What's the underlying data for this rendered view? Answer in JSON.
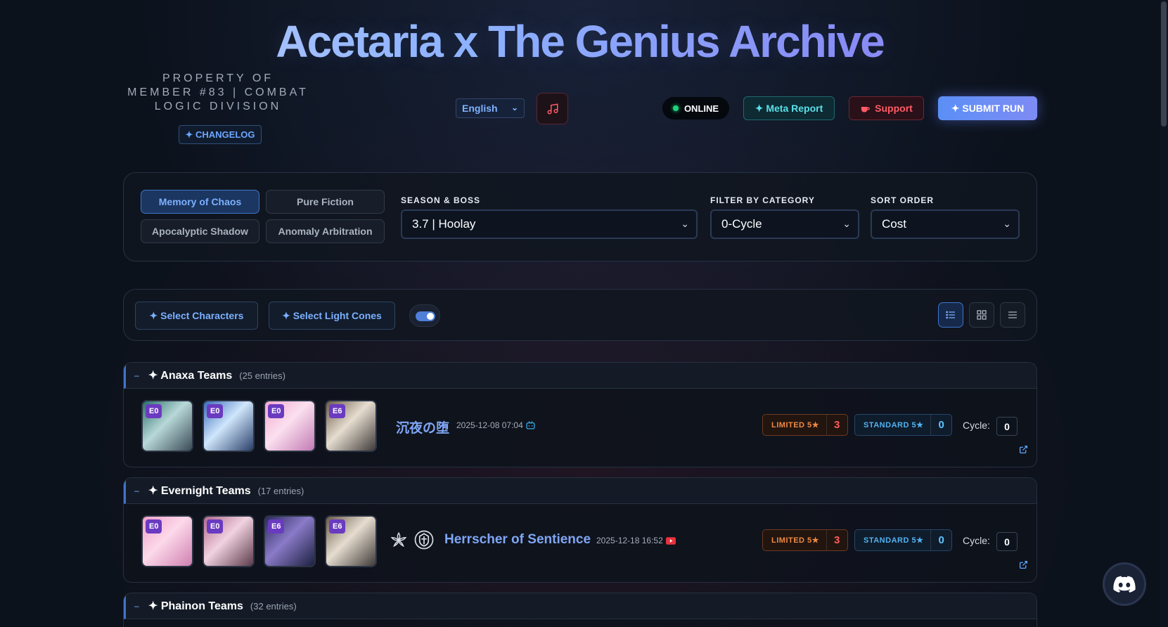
{
  "header": {
    "title": "Acetaria x The Genius Archive",
    "property_line": "PROPERTY OF MEMBER #83 | COMBAT LOGIC DIVISION",
    "changelog_label": "✦ CHANGELOG",
    "language": "English",
    "status": "ONLINE",
    "meta_report_label": "✦ Meta Report",
    "support_label": "Support",
    "submit_label": "✦ SUBMIT RUN"
  },
  "modes": [
    "Memory of Chaos",
    "Pure Fiction",
    "Apocalyptic Shadow",
    "Anomaly Arbitration"
  ],
  "active_mode": "Memory of Chaos",
  "filters": {
    "season_label": "SEASON & BOSS",
    "season_value": "3.7 | Hoolay",
    "category_label": "FILTER BY CATEGORY",
    "category_value": "0-Cycle",
    "sort_label": "SORT ORDER",
    "sort_value": "Cost"
  },
  "toolbar": {
    "select_characters": "✦ Select Characters",
    "select_light_cones": "✦ Select Light Cones",
    "toggle_on": true,
    "active_view": "list"
  },
  "groups": [
    {
      "name": "✦ Anaxa Teams",
      "count": "(25 entries)",
      "run": {
        "eidolons": [
          "E0",
          "E0",
          "E0",
          "E6"
        ],
        "title": "沉夜の堕",
        "date": "2025-12-08 07:04",
        "source_icon": "bilibili-icon",
        "limited_label": "LIMITED 5★",
        "limited_count": "3",
        "standard_label": "STANDARD 5★",
        "standard_count": "0",
        "cycle_label": "Cycle:",
        "cycle_value": "0"
      }
    },
    {
      "name": "✦ Evernight Teams",
      "count": "(17 entries)",
      "run": {
        "eidolons": [
          "E0",
          "E0",
          "E6",
          "E6"
        ],
        "title": "Herrscher of Sentience",
        "date": "2025-12-18 16:52",
        "source_icon": "youtube-icon",
        "limited_label": "LIMITED 5★",
        "limited_count": "3",
        "standard_label": "STANDARD 5★",
        "standard_count": "0",
        "cycle_label": "Cycle:",
        "cycle_value": "0"
      }
    },
    {
      "name": "✦ Phainon Teams",
      "count": "(32 entries)"
    }
  ],
  "colors": {
    "accent": "#3f74cc",
    "limited": "#ee8a45",
    "standard": "#52b2f0",
    "online": "#1ed37a"
  }
}
